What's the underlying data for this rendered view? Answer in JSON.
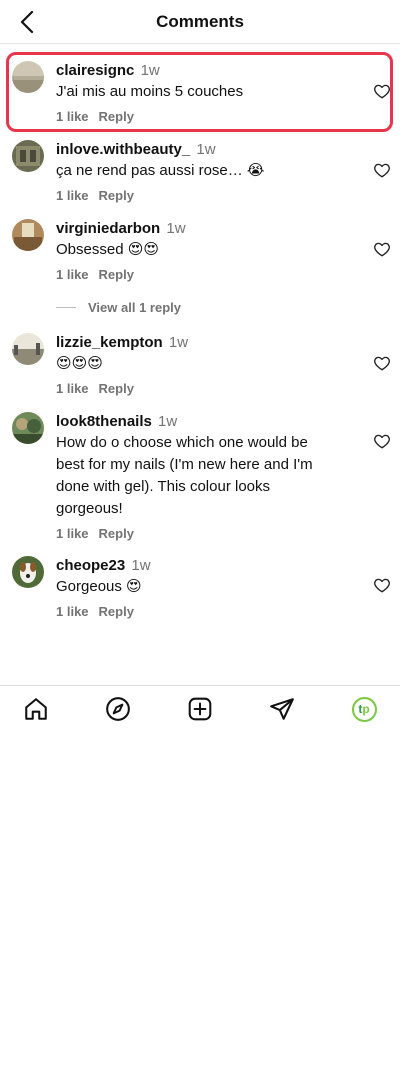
{
  "header": {
    "title": "Comments"
  },
  "comments": [
    {
      "username": "clairesignc",
      "time": "1w",
      "text": "J'ai mis au moins 5 couches",
      "likes": "1 like",
      "reply": "Reply"
    },
    {
      "username": "inlove.withbeauty_",
      "time": "1w",
      "text": "ça ne rend pas aussi rose… 😭",
      "likes": "1 like",
      "reply": "Reply"
    },
    {
      "username": "virginiedarbon",
      "time": "1w",
      "text": "Obsessed 😍😍",
      "likes": "1 like",
      "reply": "Reply"
    },
    {
      "username": "lizzie_kempton",
      "time": "1w",
      "text": "😍😍😍",
      "likes": "1 like",
      "reply": "Reply"
    },
    {
      "username": "look8thenails",
      "time": "1w",
      "text": "How do o choose which one would be best for my nails (I'm new here and I'm done with gel). This colour looks gorgeous!",
      "likes": "1 like",
      "reply": "Reply"
    },
    {
      "username": "cheope23",
      "time": "1w",
      "text": "Gorgeous 😍",
      "likes": "1 like",
      "reply": "Reply"
    }
  ],
  "view_replies": "View all 1 reply",
  "nav": {
    "items": [
      "home-icon",
      "explore-icon",
      "new-post-icon",
      "share-icon",
      "profile-avatar"
    ],
    "profile_initials_t": "t",
    "profile_initials_p": "p",
    "profile_ring_color": "#7ac943"
  },
  "colors": {
    "highlight": "#e8354b",
    "secondary_text": "#737373"
  }
}
